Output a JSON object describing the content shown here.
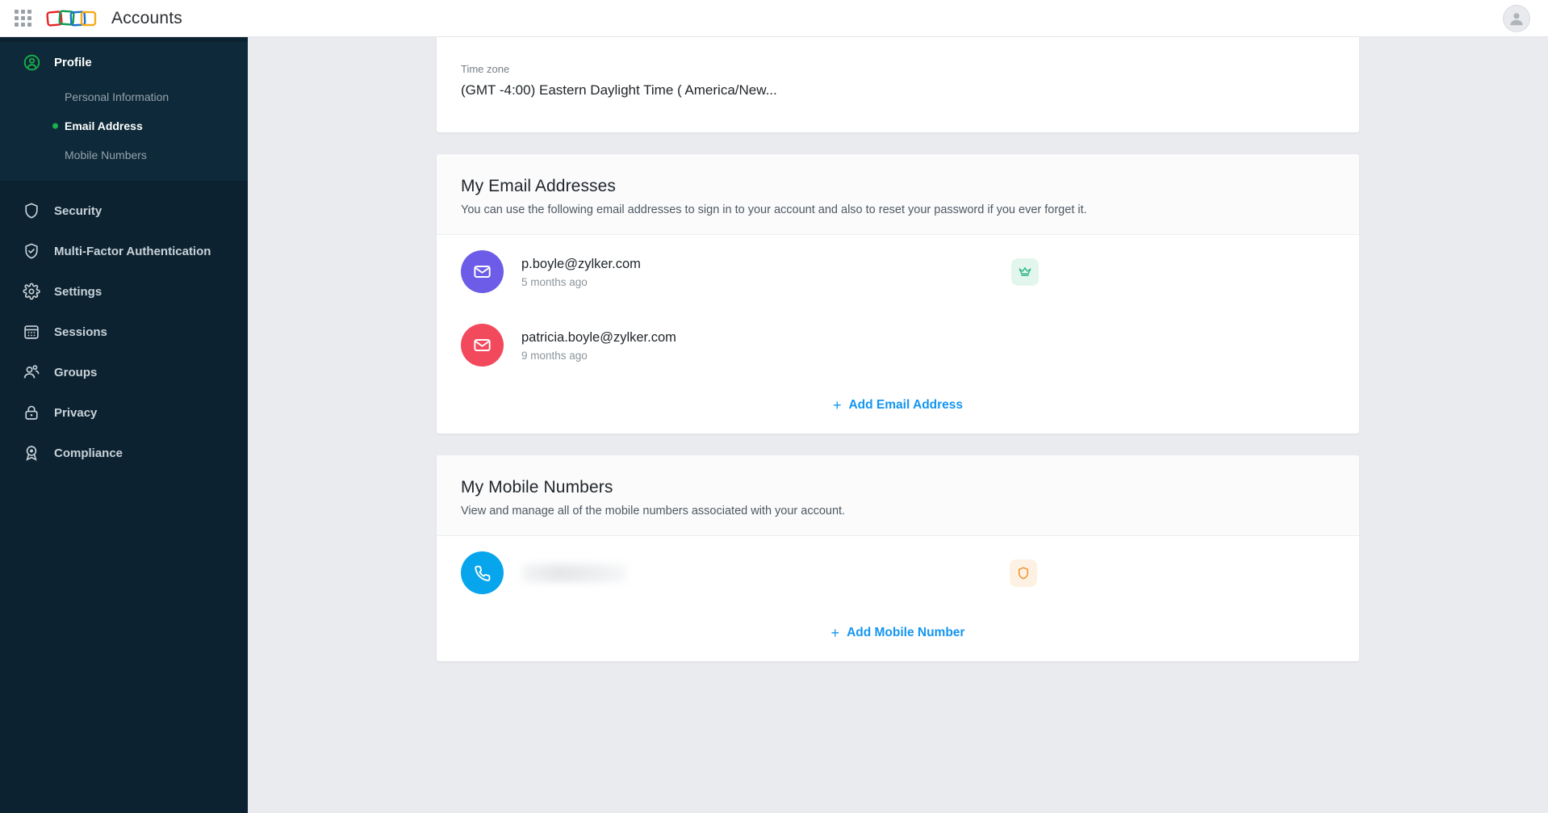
{
  "topbar": {
    "app_title": "Accounts",
    "waffle_icon": "apps-grid-icon",
    "logo_icon": "zoho-accounts-logo",
    "avatar_icon": "user-avatar-icon"
  },
  "sidebar": {
    "profile": {
      "label": "Profile",
      "icon": "user-circle-icon",
      "accent": "#19b34a",
      "sub_items": [
        {
          "label": "Personal Information",
          "active": false
        },
        {
          "label": "Email Address",
          "active": true
        },
        {
          "label": "Mobile Numbers",
          "active": false
        }
      ]
    },
    "items": [
      {
        "label": "Security",
        "icon": "shield-icon"
      },
      {
        "label": "Multi-Factor Authentication",
        "icon": "shield-check-icon"
      },
      {
        "label": "Settings",
        "icon": "gear-icon"
      },
      {
        "label": "Sessions",
        "icon": "calendar-grid-icon"
      },
      {
        "label": "Groups",
        "icon": "users-icon"
      },
      {
        "label": "Privacy",
        "icon": "lock-icon"
      },
      {
        "label": "Compliance",
        "icon": "award-badge-icon"
      }
    ]
  },
  "main": {
    "timezone_card": {
      "field_label": "Time zone",
      "field_value": "(GMT -4:00) Eastern Daylight Time ( America/New..."
    },
    "email_card": {
      "title": "My Email Addresses",
      "subtitle": "You can use the following email addresses to sign in to your account and also to reset your password if you ever forget it.",
      "rows": [
        {
          "address": "p.boyle@zylker.com",
          "meta": "5 months ago",
          "avatar_color": "#6c5ce7",
          "avatar_icon": "envelope-icon",
          "badge": "crown-icon",
          "badge_bg": "#e3f6ee",
          "badge_color": "#2eb58c"
        },
        {
          "address": "patricia.boyle@zylker.com",
          "meta": "9 months ago",
          "avatar_color": "#f2495c",
          "avatar_icon": "envelope-icon",
          "badge": null
        }
      ],
      "add_label": "Add Email Address",
      "add_plus": "+"
    },
    "mobile_card": {
      "title": "My Mobile Numbers",
      "subtitle": "View and manage all of the mobile numbers associated with your account.",
      "rows": [
        {
          "number": "",
          "redacted": true,
          "avatar_color": "#07a5ec",
          "avatar_icon": "phone-icon",
          "badge": "shield-icon",
          "badge_bg": "#fdf1e3",
          "badge_color": "#f08c24"
        }
      ],
      "add_label": "Add Mobile Number",
      "add_plus": "+"
    }
  }
}
